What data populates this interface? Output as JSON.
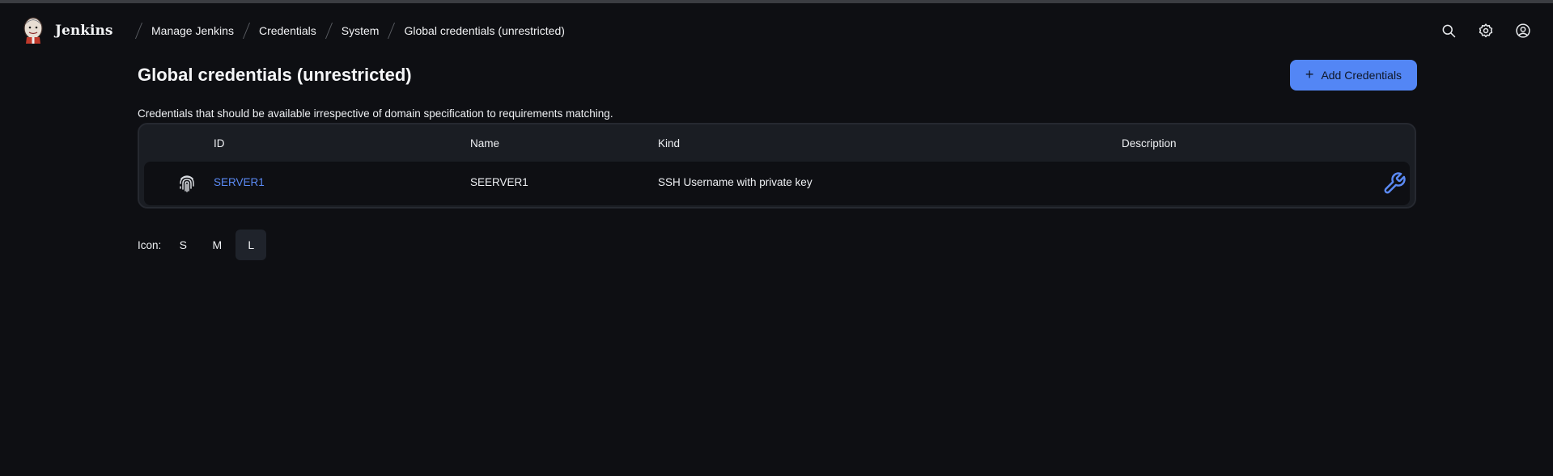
{
  "header": {
    "brand": "Jenkins",
    "breadcrumbs": [
      {
        "label": "Manage Jenkins"
      },
      {
        "label": "Credentials"
      },
      {
        "label": "System"
      },
      {
        "label": "Global credentials (unrestricted)"
      }
    ],
    "icons": [
      "search-icon",
      "gear-icon",
      "user-icon"
    ]
  },
  "main": {
    "title": "Global credentials (unrestricted)",
    "add_button_label": "Add Credentials",
    "description": "Credentials that should be available irrespective of domain specification to requirements matching.",
    "table": {
      "columns": [
        "ID",
        "Name",
        "Kind",
        "Description"
      ],
      "rows": [
        {
          "icon": "fingerprint-icon",
          "id": "SERVER1",
          "name": "SEERVER1",
          "kind": "SSH Username with private key",
          "description": "",
          "action_icon": "wrench-icon"
        }
      ]
    },
    "icon_size": {
      "label": "Icon:",
      "options": [
        "S",
        "M",
        "L"
      ],
      "selected": "L"
    }
  },
  "colors": {
    "background": "#0e0f13",
    "accent": "#5386f5",
    "link": "#5b8af4",
    "table_bg": "#1a1d23"
  }
}
